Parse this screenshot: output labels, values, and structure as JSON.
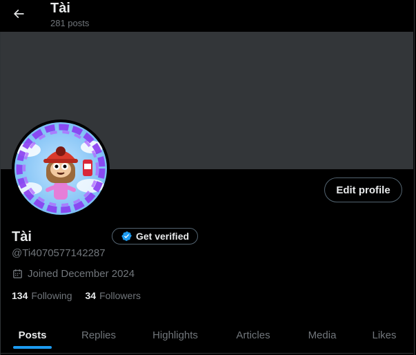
{
  "header": {
    "title": "Tài",
    "posts_count": "281 posts"
  },
  "profile": {
    "name": "Tài",
    "handle": "@Ti4070577142287",
    "joined": "Joined December 2024",
    "edit_label": "Edit profile",
    "verify_label": "Get verified",
    "following_count": "134",
    "following_label": "Following",
    "followers_count": "34",
    "followers_label": "Followers"
  },
  "tabs": [
    {
      "label": "Posts",
      "active": true
    },
    {
      "label": "Replies",
      "active": false
    },
    {
      "label": "Highlights",
      "active": false
    },
    {
      "label": "Articles",
      "active": false
    },
    {
      "label": "Media",
      "active": false
    },
    {
      "label": "Likes",
      "active": false
    }
  ],
  "colors": {
    "accent": "#1d9bf0",
    "banner": "#333639",
    "muted": "#71767b"
  }
}
